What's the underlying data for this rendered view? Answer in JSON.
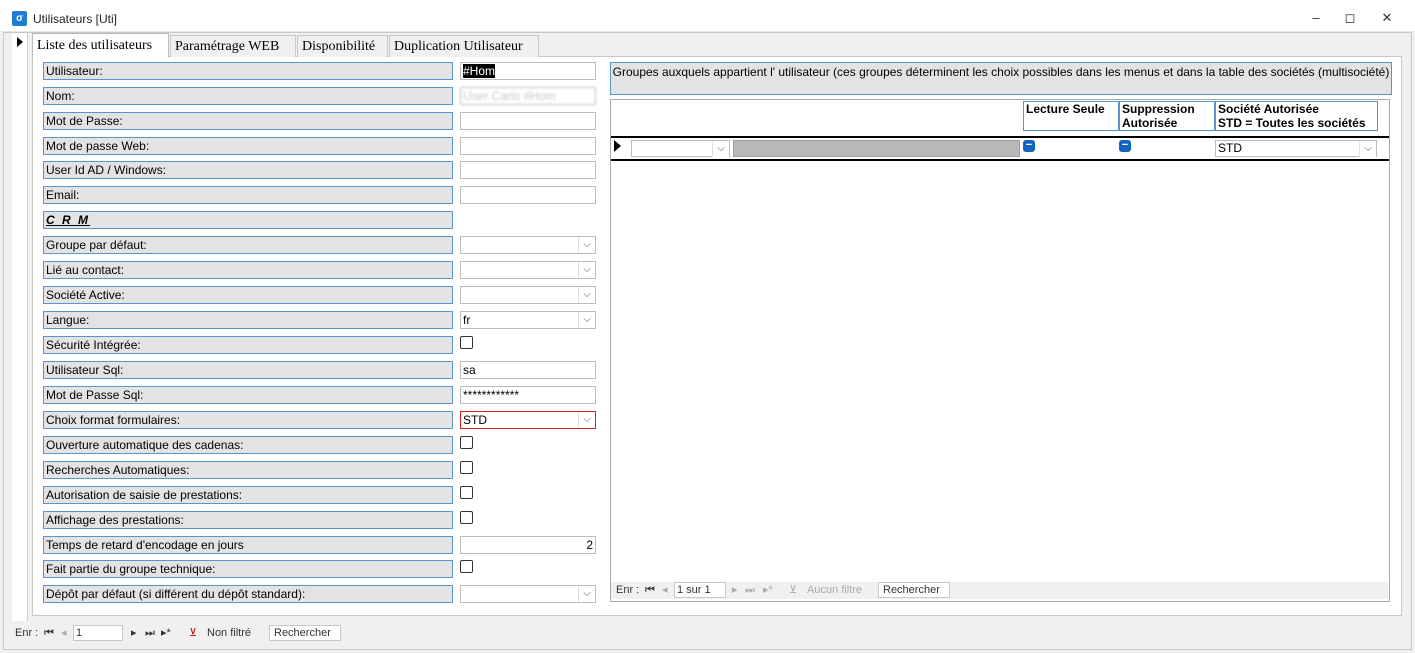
{
  "window": {
    "title": "Utilisateurs [Uti]",
    "minimize": "–",
    "restore": "◻",
    "close": "✕"
  },
  "tabs": [
    {
      "label": "Liste des utilisateurs",
      "active": true
    },
    {
      "label": "Paramétrage WEB",
      "active": false
    },
    {
      "label": "Disponibilité",
      "active": false
    },
    {
      "label": "Duplication Utilisateur",
      "active": false
    }
  ],
  "form": {
    "utilisateur": {
      "label": "Utilisateur:",
      "value": "#Hom"
    },
    "nom": {
      "label": "Nom:",
      "value": "User Carlo #Hom"
    },
    "mot_de_passe": {
      "label": "Mot de Passe:",
      "value": ""
    },
    "mot_de_passe_web": {
      "label": "Mot de passe Web:",
      "value": ""
    },
    "user_id_ad": {
      "label": "User Id AD / Windows:",
      "value": ""
    },
    "email": {
      "label": "Email:",
      "value": ""
    },
    "crm": {
      "label": "C R M"
    },
    "groupe_defaut": {
      "label": "Groupe par défaut:",
      "value": ""
    },
    "lie_contact": {
      "label": "Lié au contact:",
      "value": ""
    },
    "societe_active": {
      "label": "Société Active:",
      "value": ""
    },
    "langue": {
      "label": "Langue:",
      "value": "fr"
    },
    "securite_integree": {
      "label": "Sécurité Intégrée:",
      "checked": false
    },
    "utilisateur_sql": {
      "label": "Utilisateur Sql:",
      "value": "sa"
    },
    "mot_de_passe_sql": {
      "label": "Mot de Passe Sql:",
      "value": "************"
    },
    "choix_format": {
      "label": "Choix format formulaires:",
      "value": "STD"
    },
    "ouverture_cadenas": {
      "label": "Ouverture automatique des cadenas:",
      "checked": false
    },
    "recherches_auto": {
      "label": "Recherches Automatiques:",
      "checked": false
    },
    "autorisation_saisie": {
      "label": "Autorisation de saisie de prestations:",
      "checked": false
    },
    "affichage_prestations": {
      "label": "Affichage des prestations:",
      "checked": false
    },
    "temps_retard": {
      "label": "Temps de retard d'encodage en jours",
      "value": "2"
    },
    "groupe_technique": {
      "label": "Fait partie du groupe technique:",
      "checked": false
    },
    "depot_defaut": {
      "label": "Dépôt par défaut (si différent du dépôt standard):",
      "value": ""
    }
  },
  "groups": {
    "header": "Groupes auxquels appartient l' utilisateur (ces groupes déterminent les choix possibles dans les menus et dans la table des sociétés (multisociété)",
    "columns": {
      "lecture_seule": "Lecture Seule",
      "suppression_l1": "Suppression",
      "suppression_l2": "Autorisée",
      "societe_l1": "Société Autorisée",
      "societe_l2": "STD = Toutes les sociétés"
    },
    "row": {
      "groupe": "",
      "description": "",
      "lecture_seule": "−",
      "suppression": "−",
      "societe": "STD"
    },
    "nav": {
      "enr_label": "Enr :",
      "position": "1 sur 1",
      "filter": "Aucun filtre",
      "search": "Rechercher"
    }
  },
  "main_nav": {
    "enr_label": "Enr :",
    "position": "1",
    "filter": "Non filtré",
    "search": "Rechercher"
  }
}
